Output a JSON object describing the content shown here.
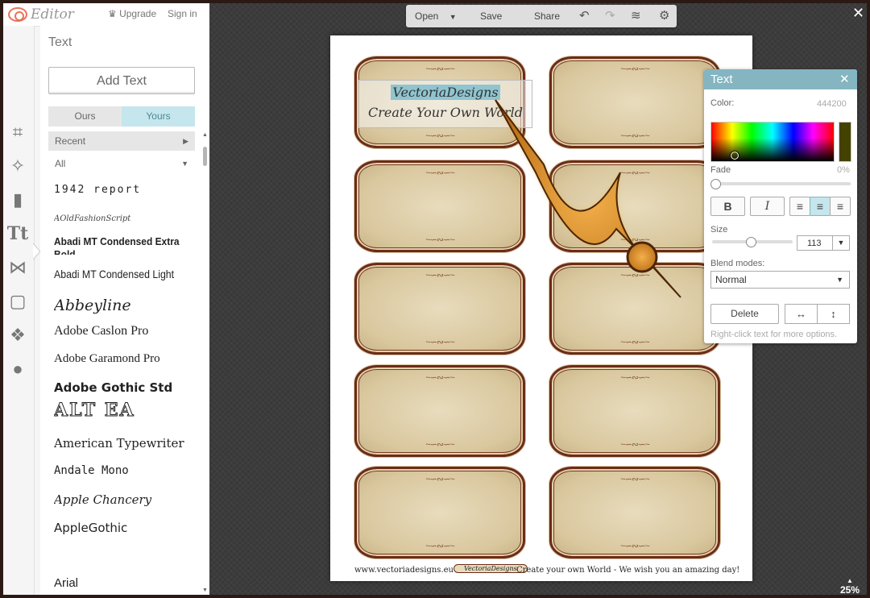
{
  "app": {
    "logo_text": "Editor",
    "upgrade": "Upgrade",
    "signin": "Sign in"
  },
  "panel": {
    "title": "Text",
    "add_text": "Add Text",
    "tabs": [
      "Ours",
      "Yours"
    ],
    "recent": "Recent",
    "all": "All",
    "fonts": [
      "1942 report",
      "AOldFashionScript",
      "Abadi MT Condensed Extra Bold",
      "Abadi MT Condensed Light",
      "Abbeyline",
      "Adobe Caslon Pro",
      "Adobe Garamond Pro",
      "Adobe Gothic Std",
      "ALT EA",
      "American Typewriter",
      "Andale Mono",
      "Apple Chancery",
      "AppleGothic",
      "Arial"
    ]
  },
  "toolbar": {
    "open": "Open",
    "save": "Save",
    "share": "Share"
  },
  "zoom": "25%",
  "document": {
    "line1": "VectoriaDesigns",
    "line2": "Create Your Own World",
    "footer_url": "www.vectoriadesigns.eu",
    "footer_badge": "VectoriaDesigns",
    "footer_text": "Create your own World - We wish you an amazing day!"
  },
  "text_dialog": {
    "title": "Text",
    "color_label": "Color:",
    "color_hex": "444200",
    "fade_label": "Fade",
    "fade_value": "0%",
    "bold": "B",
    "italic": "I",
    "size_label": "Size",
    "size_value": "113",
    "blend_label": "Blend modes:",
    "blend_value": "Normal",
    "delete": "Delete",
    "hint": "Right-click text for more options."
  },
  "colors": {
    "accent": "#84b5c1",
    "tab_active": "#c5e6ec",
    "text_color": "#444200"
  }
}
